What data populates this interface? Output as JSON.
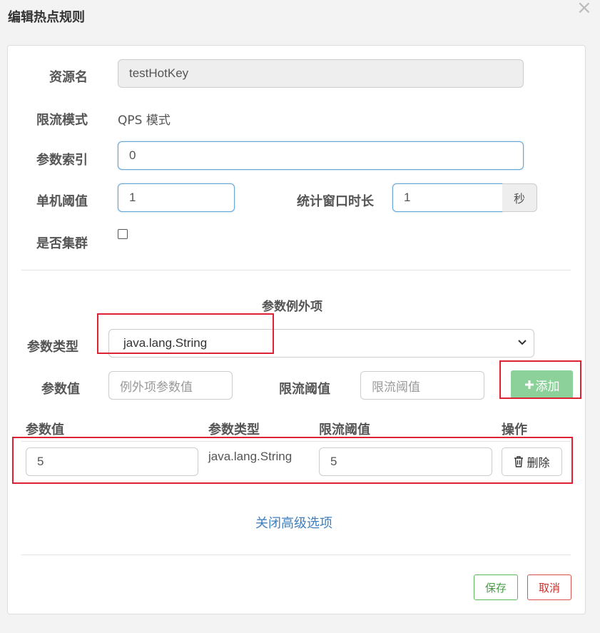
{
  "dialog": {
    "title": "编辑热点规则",
    "close_glyph": "×"
  },
  "form": {
    "resource_label": "资源名",
    "resource_value": "testHotKey",
    "mode_label": "限流模式",
    "mode_value": "QPS 模式",
    "param_index_label": "参数索引",
    "param_index_value": "0",
    "threshold_label": "单机阈值",
    "threshold_value": "1",
    "window_label": "统计窗口时长",
    "window_value": "1",
    "window_unit": "秒",
    "cluster_label": "是否集群",
    "cluster_checked": false
  },
  "exceptions": {
    "heading": "参数例外项",
    "type_label": "参数类型",
    "type_selected": "java.lang.String",
    "value_label": "参数值",
    "value_placeholder": "例外项参数值",
    "limit_label": "限流阈值",
    "limit_placeholder": "限流阈值",
    "add_button": "添加",
    "table": {
      "headers": [
        "参数值",
        "参数类型",
        "限流阈值",
        "操作"
      ],
      "rows": [
        {
          "value": "5",
          "type": "java.lang.String",
          "limit": "5",
          "action": "删除"
        }
      ]
    }
  },
  "advanced_link": "关闭高级选项",
  "footer": {
    "save": "保存",
    "cancel": "取消"
  },
  "colors": {
    "link": "#3f7fbf",
    "add_button_bg": "#8cd19a",
    "save_border": "#5cb85c",
    "cancel_border": "#d9534f",
    "annotation_red": "#dd2233"
  },
  "icons": [
    "close-icon",
    "chevron-down-icon",
    "plus-icon",
    "trash-icon"
  ]
}
